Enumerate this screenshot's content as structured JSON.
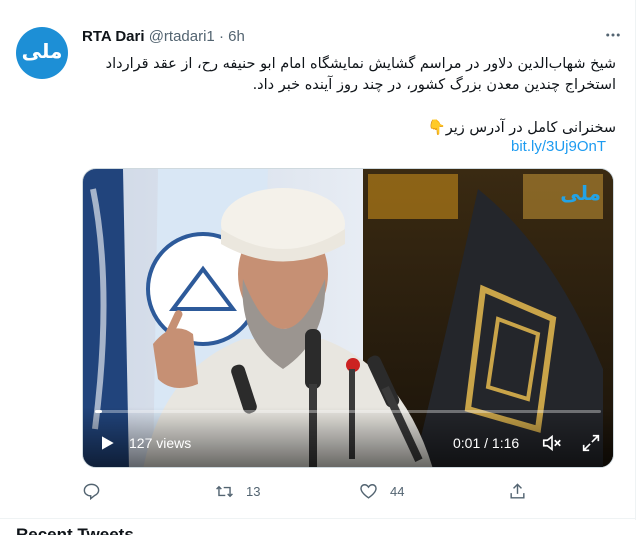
{
  "tweet": {
    "author_name": "RTA Dari",
    "handle": "@rtadari1",
    "separator": "·",
    "time": "6h",
    "avatar_logo_text": "ملی",
    "more_icon": "more-dots-icon",
    "text_line1": "شیخ شهاب‌الدین دلاور در مراسم گشایش نمایشگاه امام ابو حنیفه رح، از عقد قرارداد استخراج چندین معدن بزرگ کشور، در چند روز آینده خبر داد.",
    "text_line2": "سخنرانی کامل در آدرس زیر👇",
    "link": "bit.ly/3Uj9OnT"
  },
  "video": {
    "views": "127 views",
    "timecode": "0:01 / 1:16",
    "progress": 0.013,
    "watermark": "ملی",
    "play_icon": "play-icon",
    "volume_icon": "volume-icon",
    "fullscreen_icon": "fullscreen-icon"
  },
  "actions": {
    "reply_count": "",
    "retweet_count": "13",
    "like_count": "44",
    "share_count": ""
  },
  "next_section": {
    "heading": "Recent Tweets"
  },
  "colors": {
    "accent": "#1d9bf0",
    "secondary_text": "#536471",
    "avatar_bg": "#1d8fd6"
  }
}
